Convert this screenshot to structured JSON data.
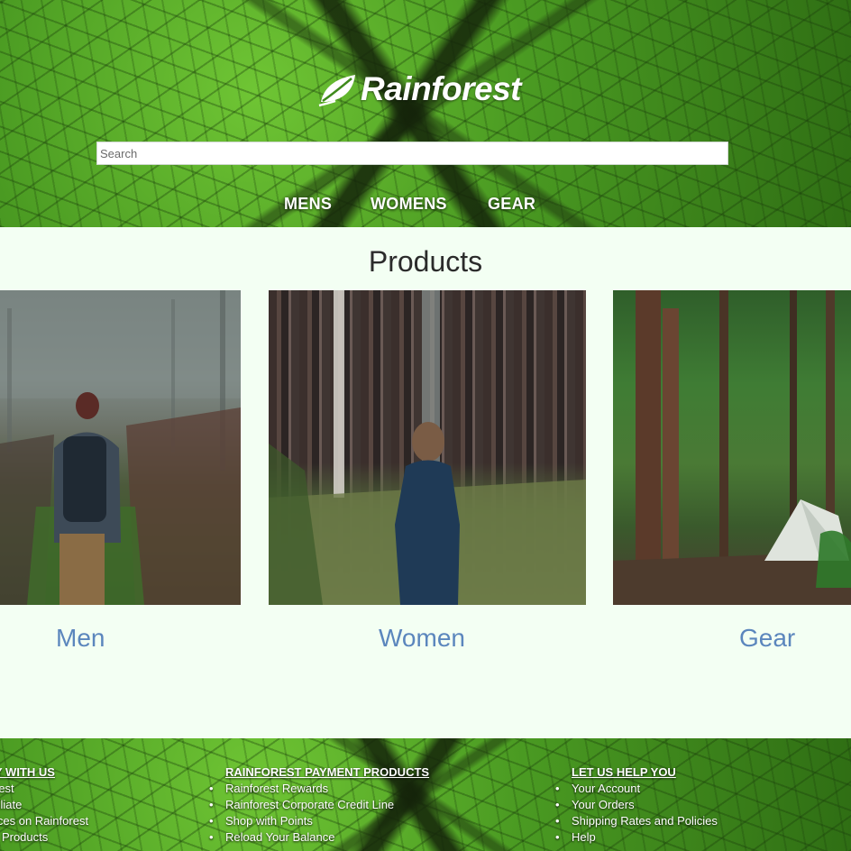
{
  "header": {
    "logo_text": "Rainforest",
    "search_placeholder": "Search",
    "nav": [
      "MENS",
      "WOMENS",
      "GEAR"
    ]
  },
  "main": {
    "title": "Products",
    "cards": [
      {
        "label": "Men",
        "image": "man-walking-in-misty-field-photo"
      },
      {
        "label": "Women",
        "image": "woman-standing-in-pine-forest-photo"
      },
      {
        "label": "Gear",
        "image": "tent-in-forest-photo"
      }
    ]
  },
  "footer": {
    "columns": [
      {
        "heading": "Y WITH US",
        "items": [
          "rest",
          "filiate",
          "ices on Rainforest",
          "r Products"
        ]
      },
      {
        "heading": "RAINFOREST PAYMENT PRODUCTS",
        "items": [
          "Rainforest Rewards",
          "Rainforest Corporate Credit Line",
          "Shop with Points",
          "Reload Your Balance"
        ]
      },
      {
        "heading": "LET US HELP YOU",
        "items": [
          "Your Account",
          "Your Orders",
          "Shipping Rates and Policies",
          "Help"
        ]
      }
    ]
  },
  "colors": {
    "page_background": "#f3fff3",
    "card_label": "#5b86bd",
    "title_text": "#2b2b2b",
    "nav_text": "#ffffff"
  }
}
